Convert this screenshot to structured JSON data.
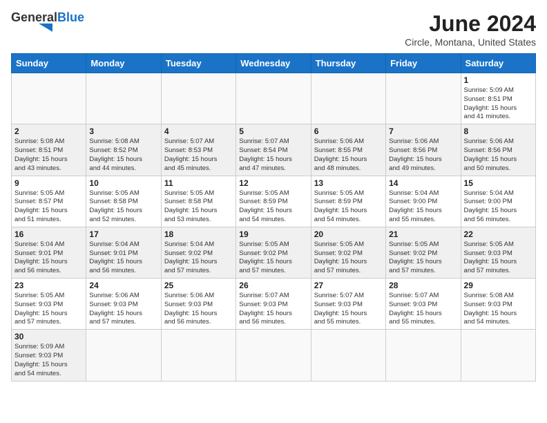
{
  "header": {
    "logo_general": "General",
    "logo_blue": "Blue",
    "month_title": "June 2024",
    "location": "Circle, Montana, United States"
  },
  "weekdays": [
    "Sunday",
    "Monday",
    "Tuesday",
    "Wednesday",
    "Thursday",
    "Friday",
    "Saturday"
  ],
  "weeks": [
    [
      {
        "day": "",
        "info": ""
      },
      {
        "day": "",
        "info": ""
      },
      {
        "day": "",
        "info": ""
      },
      {
        "day": "",
        "info": ""
      },
      {
        "day": "",
        "info": ""
      },
      {
        "day": "",
        "info": ""
      },
      {
        "day": "1",
        "info": "Sunrise: 5:09 AM\nSunset: 8:51 PM\nDaylight: 15 hours\nand 41 minutes."
      }
    ],
    [
      {
        "day": "2",
        "info": "Sunrise: 5:08 AM\nSunset: 8:51 PM\nDaylight: 15 hours\nand 43 minutes."
      },
      {
        "day": "3",
        "info": "Sunrise: 5:08 AM\nSunset: 8:52 PM\nDaylight: 15 hours\nand 44 minutes."
      },
      {
        "day": "4",
        "info": "Sunrise: 5:07 AM\nSunset: 8:53 PM\nDaylight: 15 hours\nand 45 minutes."
      },
      {
        "day": "5",
        "info": "Sunrise: 5:07 AM\nSunset: 8:54 PM\nDaylight: 15 hours\nand 47 minutes."
      },
      {
        "day": "6",
        "info": "Sunrise: 5:06 AM\nSunset: 8:55 PM\nDaylight: 15 hours\nand 48 minutes."
      },
      {
        "day": "7",
        "info": "Sunrise: 5:06 AM\nSunset: 8:56 PM\nDaylight: 15 hours\nand 49 minutes."
      },
      {
        "day": "8",
        "info": "Sunrise: 5:06 AM\nSunset: 8:56 PM\nDaylight: 15 hours\nand 50 minutes."
      }
    ],
    [
      {
        "day": "9",
        "info": "Sunrise: 5:05 AM\nSunset: 8:57 PM\nDaylight: 15 hours\nand 51 minutes."
      },
      {
        "day": "10",
        "info": "Sunrise: 5:05 AM\nSunset: 8:58 PM\nDaylight: 15 hours\nand 52 minutes."
      },
      {
        "day": "11",
        "info": "Sunrise: 5:05 AM\nSunset: 8:58 PM\nDaylight: 15 hours\nand 53 minutes."
      },
      {
        "day": "12",
        "info": "Sunrise: 5:05 AM\nSunset: 8:59 PM\nDaylight: 15 hours\nand 54 minutes."
      },
      {
        "day": "13",
        "info": "Sunrise: 5:05 AM\nSunset: 8:59 PM\nDaylight: 15 hours\nand 54 minutes."
      },
      {
        "day": "14",
        "info": "Sunrise: 5:04 AM\nSunset: 9:00 PM\nDaylight: 15 hours\nand 55 minutes."
      },
      {
        "day": "15",
        "info": "Sunrise: 5:04 AM\nSunset: 9:00 PM\nDaylight: 15 hours\nand 56 minutes."
      }
    ],
    [
      {
        "day": "16",
        "info": "Sunrise: 5:04 AM\nSunset: 9:01 PM\nDaylight: 15 hours\nand 56 minutes."
      },
      {
        "day": "17",
        "info": "Sunrise: 5:04 AM\nSunset: 9:01 PM\nDaylight: 15 hours\nand 56 minutes."
      },
      {
        "day": "18",
        "info": "Sunrise: 5:04 AM\nSunset: 9:02 PM\nDaylight: 15 hours\nand 57 minutes."
      },
      {
        "day": "19",
        "info": "Sunrise: 5:05 AM\nSunset: 9:02 PM\nDaylight: 15 hours\nand 57 minutes."
      },
      {
        "day": "20",
        "info": "Sunrise: 5:05 AM\nSunset: 9:02 PM\nDaylight: 15 hours\nand 57 minutes."
      },
      {
        "day": "21",
        "info": "Sunrise: 5:05 AM\nSunset: 9:02 PM\nDaylight: 15 hours\nand 57 minutes."
      },
      {
        "day": "22",
        "info": "Sunrise: 5:05 AM\nSunset: 9:03 PM\nDaylight: 15 hours\nand 57 minutes."
      }
    ],
    [
      {
        "day": "23",
        "info": "Sunrise: 5:05 AM\nSunset: 9:03 PM\nDaylight: 15 hours\nand 57 minutes."
      },
      {
        "day": "24",
        "info": "Sunrise: 5:06 AM\nSunset: 9:03 PM\nDaylight: 15 hours\nand 57 minutes."
      },
      {
        "day": "25",
        "info": "Sunrise: 5:06 AM\nSunset: 9:03 PM\nDaylight: 15 hours\nand 56 minutes."
      },
      {
        "day": "26",
        "info": "Sunrise: 5:07 AM\nSunset: 9:03 PM\nDaylight: 15 hours\nand 56 minutes."
      },
      {
        "day": "27",
        "info": "Sunrise: 5:07 AM\nSunset: 9:03 PM\nDaylight: 15 hours\nand 55 minutes."
      },
      {
        "day": "28",
        "info": "Sunrise: 5:07 AM\nSunset: 9:03 PM\nDaylight: 15 hours\nand 55 minutes."
      },
      {
        "day": "29",
        "info": "Sunrise: 5:08 AM\nSunset: 9:03 PM\nDaylight: 15 hours\nand 54 minutes."
      }
    ],
    [
      {
        "day": "30",
        "info": "Sunrise: 5:09 AM\nSunset: 9:03 PM\nDaylight: 15 hours\nand 54 minutes."
      },
      {
        "day": "",
        "info": ""
      },
      {
        "day": "",
        "info": ""
      },
      {
        "day": "",
        "info": ""
      },
      {
        "day": "",
        "info": ""
      },
      {
        "day": "",
        "info": ""
      },
      {
        "day": "",
        "info": ""
      }
    ]
  ]
}
